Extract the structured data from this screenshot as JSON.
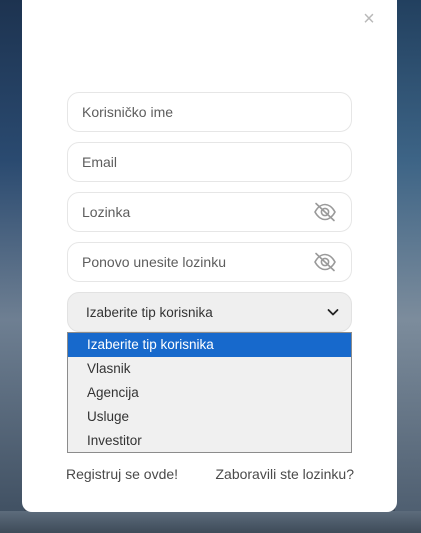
{
  "modal": {
    "close_symbol": "×"
  },
  "form": {
    "username_placeholder": "Korisničko ime",
    "email_placeholder": "Email",
    "password_placeholder": "Lozinka",
    "password_repeat_placeholder": "Ponovo unesite lozinku",
    "user_type_select": {
      "selected_label": "Izaberite tip korisnika",
      "options": [
        "Izaberite tip korisnika",
        "Vlasnik",
        "Agencija",
        "Usluge",
        "Investitor"
      ]
    }
  },
  "links": {
    "register": "Registruj se ovde!",
    "forgot_password": "Zaboravili ste lozinku?"
  },
  "icons": {
    "password_toggle": "eye-slash-icon",
    "select_arrow": "chevron-down-icon",
    "close": "close-icon"
  },
  "colors": {
    "selected_option": "#1769cc",
    "modal_bg": "#ffffff",
    "select_bg": "#efefef"
  }
}
